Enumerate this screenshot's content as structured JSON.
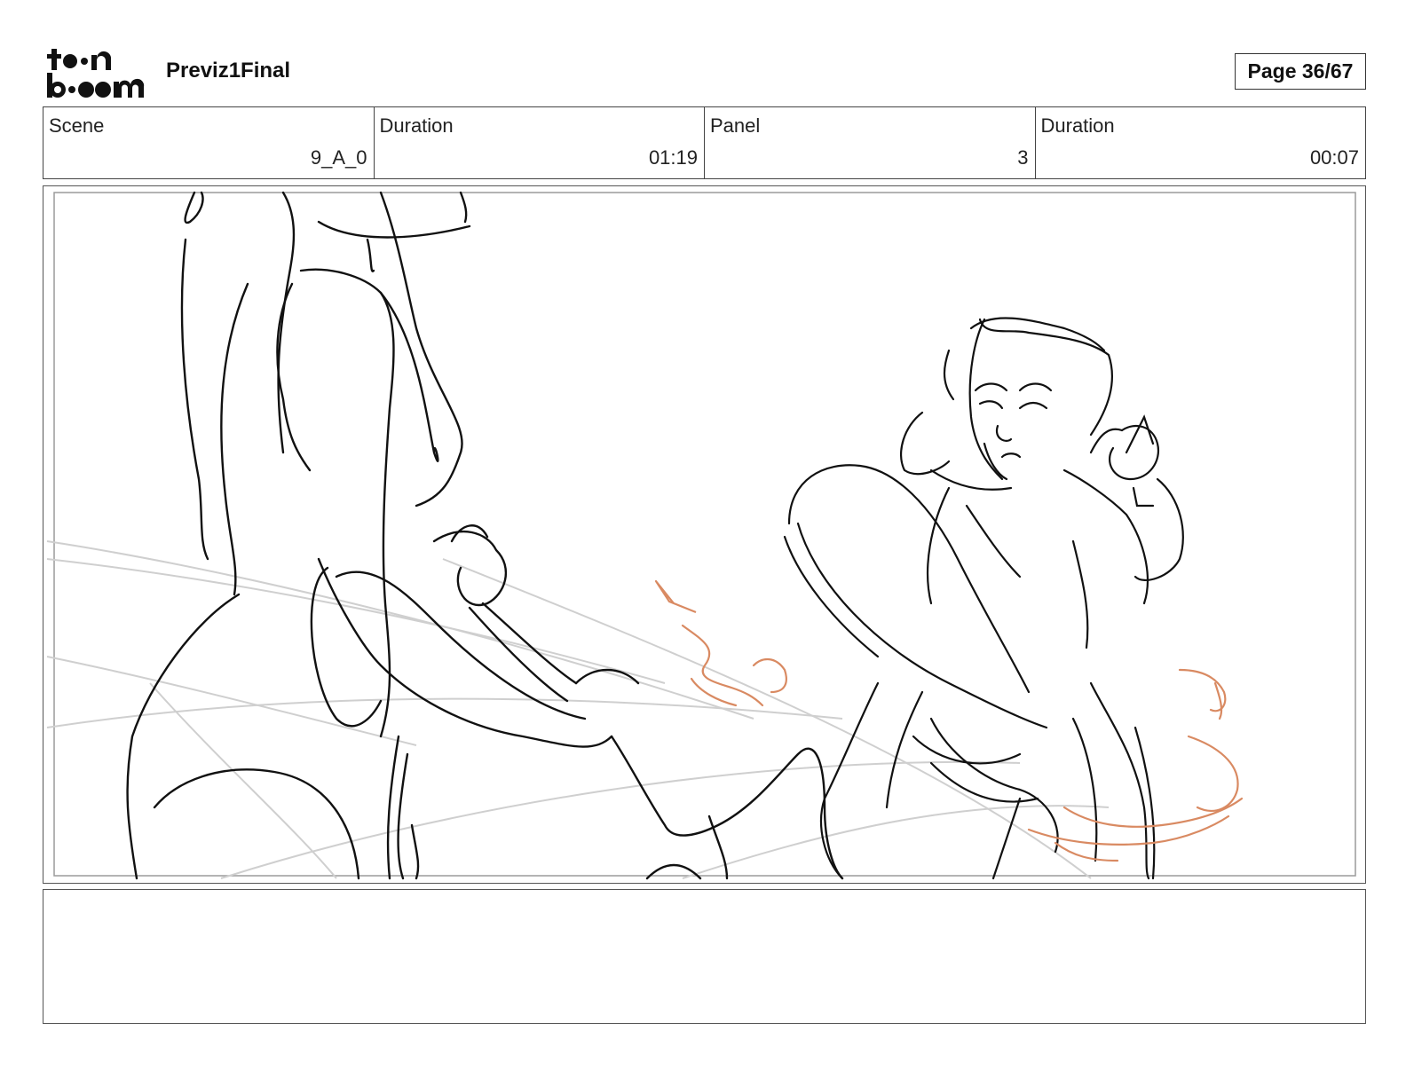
{
  "header": {
    "logo": "toon-boom-logo",
    "project_title": "Previz1Final",
    "page_label": "Page 36/67"
  },
  "info": {
    "scene_label": "Scene",
    "scene_value": "9_A_0",
    "scene_duration_label": "Duration",
    "scene_duration_value": "01:19",
    "panel_label": "Panel",
    "panel_value": "3",
    "panel_duration_label": "Duration",
    "panel_duration_value": "00:07"
  },
  "panel": {
    "image": "storyboard-sketch",
    "line_color": "#111111",
    "guide_color": "#c8c8c8",
    "effect_color": "#d98a62"
  },
  "notes": {
    "text": ""
  }
}
